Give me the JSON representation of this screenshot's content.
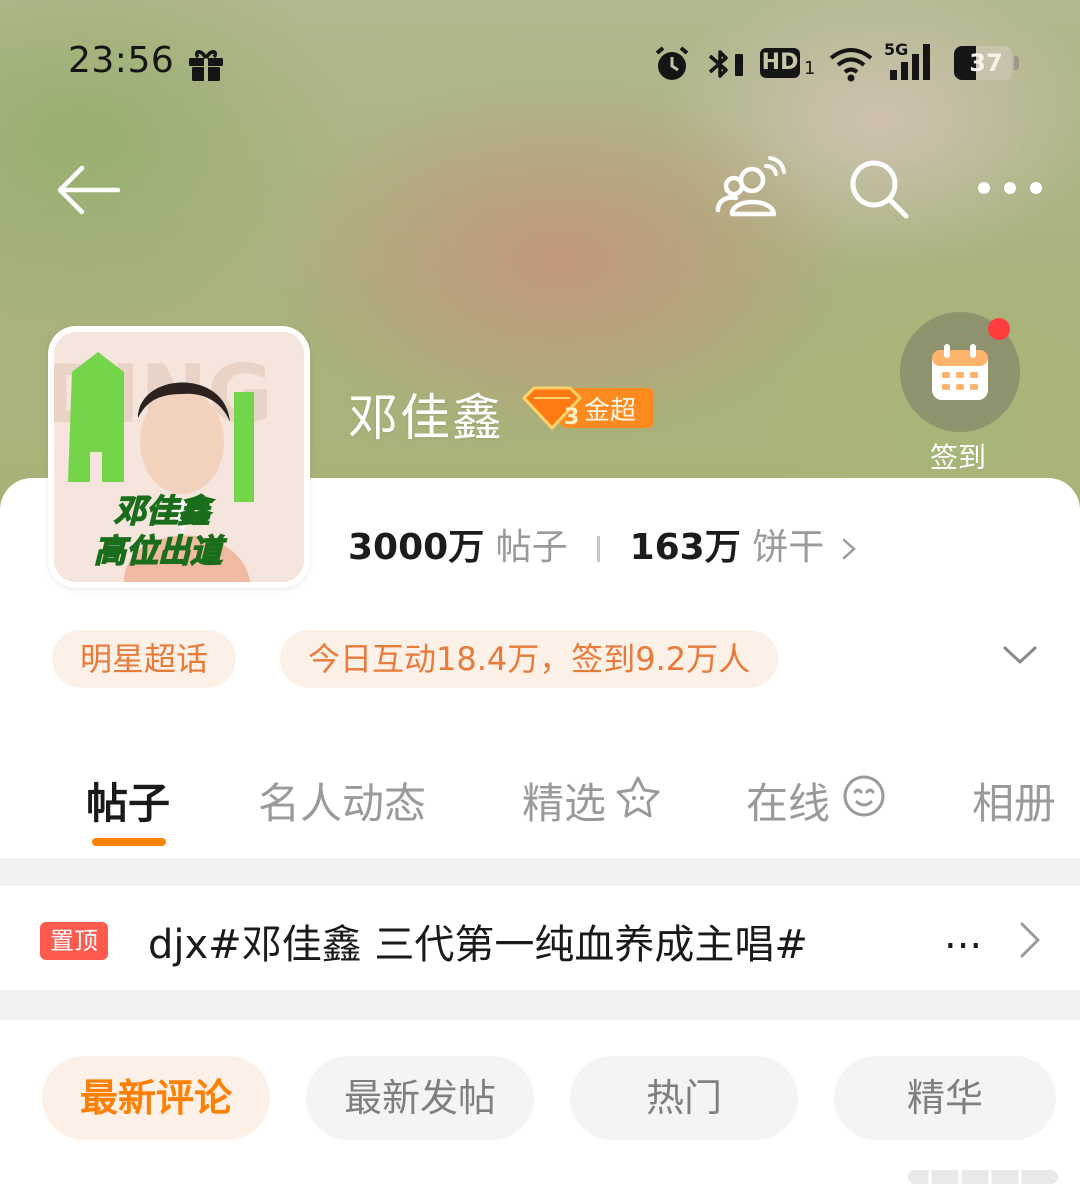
{
  "status_bar": {
    "time": "23:56",
    "battery": "37",
    "network": "5G",
    "hd_label": "HD",
    "hd_sub": "1",
    "icons": [
      "gift-icon",
      "alarm-icon",
      "bluetooth-icon",
      "hd-icon",
      "wifi-icon",
      "signal-icon",
      "battery-icon"
    ]
  },
  "nav": {
    "icons": [
      "back-arrow-icon",
      "group-chat-icon",
      "search-icon",
      "more-icon"
    ]
  },
  "topic": {
    "name": "邓佳鑫",
    "badge_level": "3",
    "badge_label": "金超",
    "avatar_text": "邓佳鑫 高位出道",
    "checkin_label": "签到",
    "posts_count": "3000万",
    "posts_label": "帖子",
    "fans_count": "163万",
    "fans_label": "饼干",
    "category_pill": "明星超话",
    "activity_pill": "今日互动18.4万，签到9.2万人"
  },
  "tabs": [
    {
      "label": "帖子",
      "active": true
    },
    {
      "label": "名人动态",
      "active": false
    },
    {
      "label": "精选",
      "active": false
    },
    {
      "label": "在线",
      "active": false
    },
    {
      "label": "相册",
      "active": false
    }
  ],
  "pinned": {
    "tag": "置顶",
    "title": "djx#邓佳鑫 三代第一纯血养成主唱#",
    "ellipsis": "..."
  },
  "sort_options": [
    {
      "label": "最新评论",
      "active": true
    },
    {
      "label": "最新发帖",
      "active": false
    },
    {
      "label": "热门",
      "active": false
    },
    {
      "label": "精华",
      "active": false
    }
  ],
  "colors": {
    "accent": "#ff8200",
    "pill_bg": "#fdf0e7",
    "pill_text": "#e87a3a",
    "pin_tag": "#ff5a4e"
  }
}
